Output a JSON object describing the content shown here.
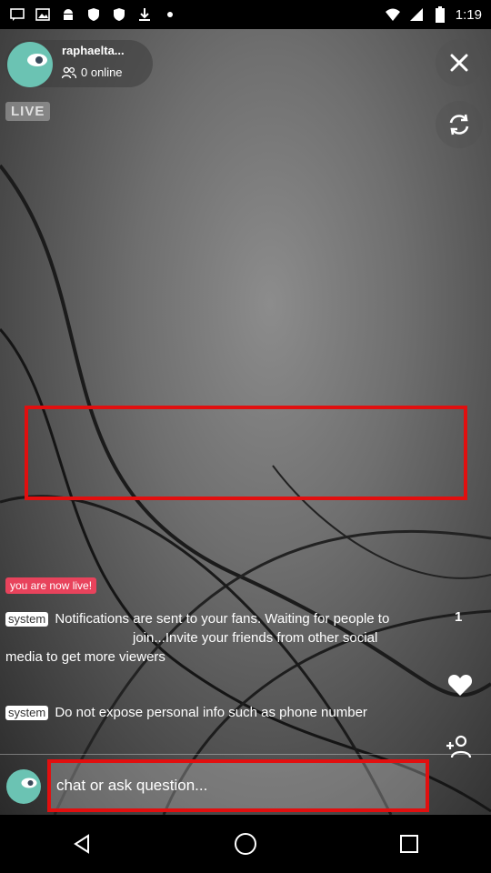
{
  "status_bar": {
    "time": "1:19"
  },
  "host": {
    "name": "raphaelta...",
    "online_text": "0 online"
  },
  "live_badge": "LIVE",
  "now_live_tag": "you are now live!",
  "messages": [
    {
      "tag": "system",
      "text_line1": "Notifications are sent to your fans. Waiting for people to",
      "text_line2": "join...Invite your friends from other social media to get more viewers"
    },
    {
      "tag": "system",
      "text": "Do not expose personal info such as phone number"
    }
  ],
  "like_count": "1",
  "chat": {
    "placeholder": "chat or ask question..."
  },
  "icons": {
    "close": "close-icon",
    "refresh": "refresh-icon",
    "heart": "heart-icon",
    "add_user": "add-user-icon",
    "back": "back-icon",
    "home": "home-icon",
    "recents": "recents-icon"
  },
  "colors": {
    "highlight": "#e10f0f",
    "live_pink": "#e8435c",
    "avatar_teal": "#6bc3b3"
  }
}
